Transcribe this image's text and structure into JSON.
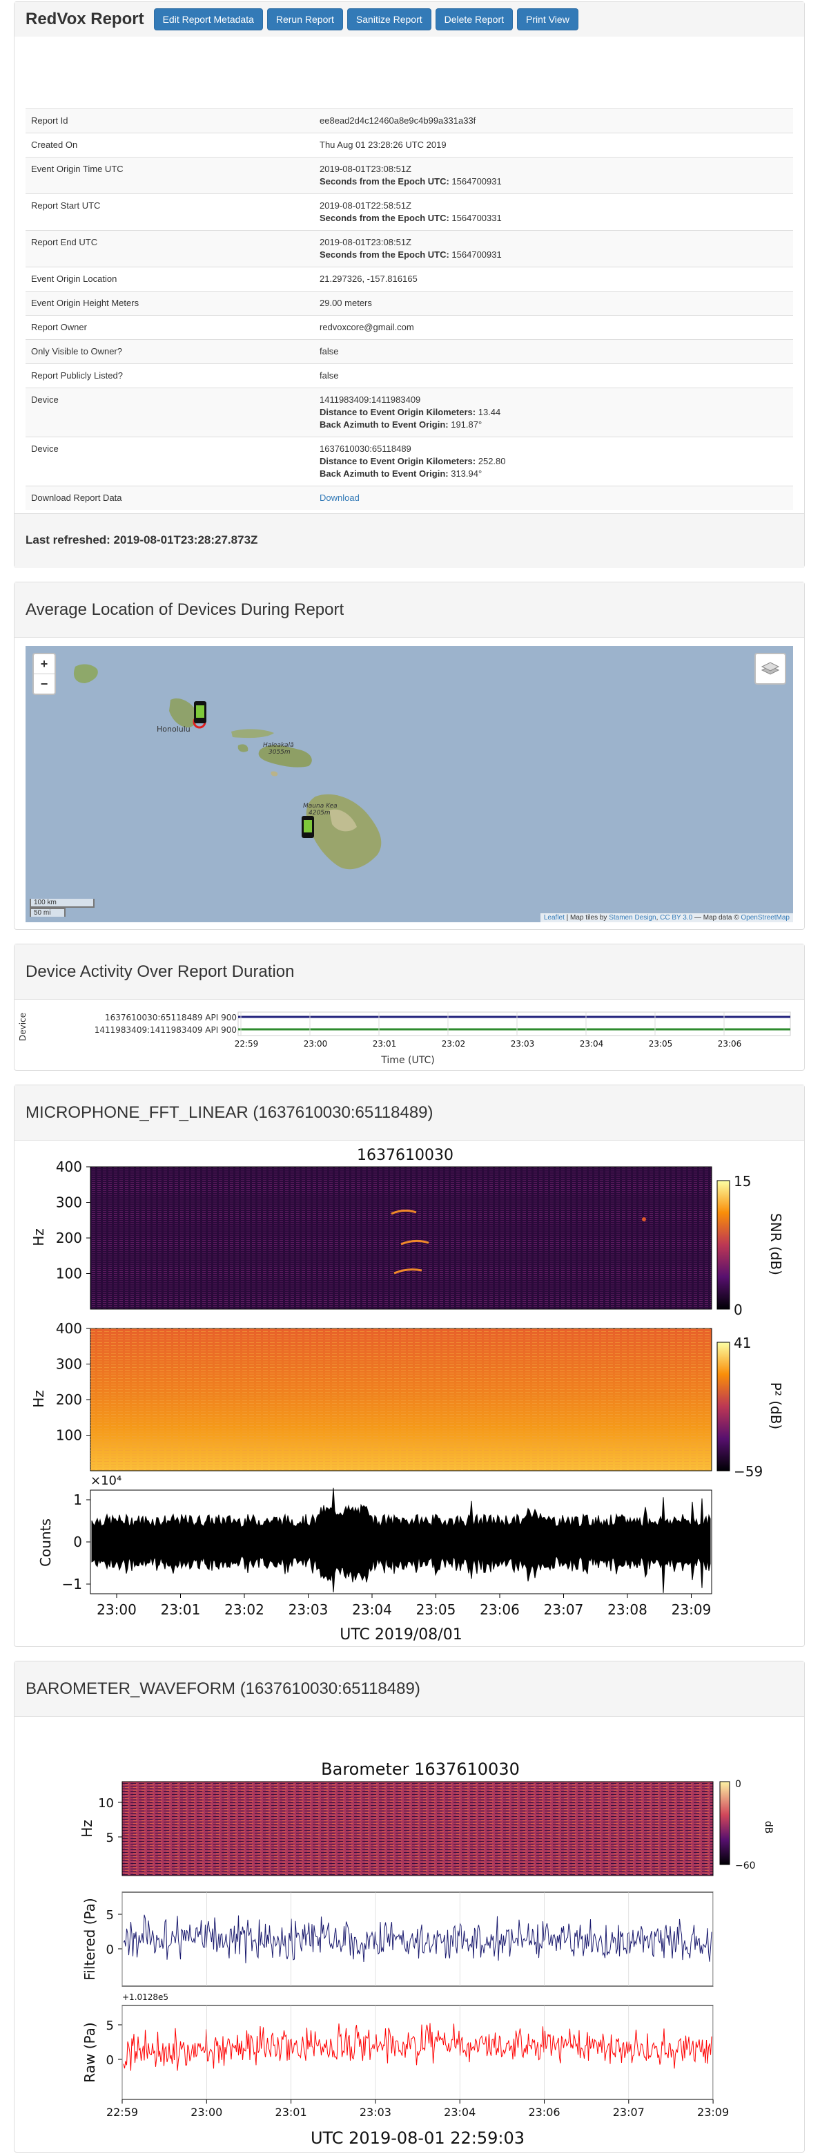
{
  "header": {
    "title": "RedVox Report",
    "buttons": [
      "Edit Report Metadata",
      "Rerun Report",
      "Sanitize Report",
      "Delete Report",
      "Print View"
    ]
  },
  "metadata": [
    {
      "key": "Report Id",
      "value": "ee8ead2d4c12460a8e9c4b99a331a33f"
    },
    {
      "key": "Created On",
      "value": "Thu Aug 01 23:28:26 UTC 2019"
    },
    {
      "key": "Event Origin Time UTC",
      "value": "2019-08-01T23:08:51Z",
      "sub": [
        {
          "label": "Seconds from the Epoch UTC:",
          "value": "1564700931"
        }
      ]
    },
    {
      "key": "Report Start UTC",
      "value": "2019-08-01T22:58:51Z",
      "sub": [
        {
          "label": "Seconds from the Epoch UTC:",
          "value": "1564700331"
        }
      ]
    },
    {
      "key": "Report End UTC",
      "value": "2019-08-01T23:08:51Z",
      "sub": [
        {
          "label": "Seconds from the Epoch UTC:",
          "value": "1564700931"
        }
      ]
    },
    {
      "key": "Event Origin Location",
      "value": "21.297326, -157.816165"
    },
    {
      "key": "Event Origin Height Meters",
      "value": "29.00 meters"
    },
    {
      "key": "Report Owner",
      "value": "redvoxcore@gmail.com"
    },
    {
      "key": "Only Visible to Owner?",
      "value": "false"
    },
    {
      "key": "Report Publicly Listed?",
      "value": "false"
    },
    {
      "key": "Device",
      "value": "1411983409:1411983409",
      "sub": [
        {
          "label": "Distance to Event Origin Kilometers:",
          "value": "13.44"
        },
        {
          "label": "Back Azimuth to Event Origin:",
          "value": "191.87°"
        }
      ]
    },
    {
      "key": "Device",
      "value": "1637610030:65118489",
      "sub": [
        {
          "label": "Distance to Event Origin Kilometers:",
          "value": "252.80"
        },
        {
          "label": "Back Azimuth to Event Origin:",
          "value": "313.94°"
        }
      ]
    },
    {
      "key": "Download Report Data",
      "value": "Download",
      "link": true
    }
  ],
  "refresh": "Last refreshed: 2019-08-01T23:28:27.873Z",
  "map": {
    "title": "Average Location of Devices During Report",
    "zoom_in": "+",
    "zoom_out": "−",
    "places": [
      "Honolulu",
      "Haleakalā",
      "3055m",
      "Mauna Kea",
      "4205m"
    ],
    "scale": [
      "100 km",
      "50 mi"
    ],
    "attribution": {
      "leaflet": "Leaflet",
      "tiles_prefix": " | Map tiles by ",
      "stamen": "Stamen Design",
      "sep": ", ",
      "cc": "CC BY 3.0",
      "data_prefix": " — Map data © ",
      "osm": "OpenStreetMap"
    }
  },
  "activity": {
    "title": "Device Activity Over Report Duration",
    "ylabel": "Device",
    "xlabel": "Time (UTC)",
    "devices": [
      "1637610030:65118489 API 900",
      "1411983409:1411983409 API 900"
    ],
    "colors": [
      "#1f1f7a",
      "#2e8b2e"
    ],
    "ticks": [
      "22:59",
      "23:00",
      "23:01",
      "23:02",
      "23:03",
      "23:04",
      "23:05",
      "23:06"
    ]
  },
  "fft": {
    "title": "MICROPHONE_FFT_LINEAR (1637610030:65118489)",
    "plot_title": "1637610030",
    "hz_ticks": [
      "400",
      "300",
      "200",
      "100"
    ],
    "hz_label": "Hz",
    "snr": {
      "label": "SNR (dB)",
      "max": "15",
      "min": "0"
    },
    "p2": {
      "label": "P² (dB)",
      "max": "41",
      "min": "−59"
    },
    "exp": "×10⁴",
    "counts_ticks": [
      "1",
      "0",
      "−1"
    ],
    "counts_label": "Counts",
    "x_ticks": [
      "23:00",
      "23:01",
      "23:02",
      "23:03",
      "23:04",
      "23:05",
      "23:06",
      "23:07",
      "23:08",
      "23:09"
    ],
    "x_label": "UTC 2019/08/01"
  },
  "baro": {
    "title": "BAROMETER_WAVEFORM (1637610030:65118489)",
    "plot_title": "Barometer 1637610030",
    "hz_label": "Hz",
    "hz_ticks": [
      "10",
      "5"
    ],
    "cbar": {
      "label": "dB",
      "max": "0",
      "min": "−60"
    },
    "filtered_label": "Filtered (Pa)",
    "filtered_ticks": [
      "5",
      "0"
    ],
    "raw_label": "Raw (Pa)",
    "raw_offset": "+1.0128e5",
    "raw_ticks": [
      "5",
      "0"
    ],
    "x_ticks": [
      "22:59",
      "23:00",
      "23:01",
      "23:03",
      "23:04",
      "23:06",
      "23:07",
      "23:09"
    ],
    "x_label": "UTC 2019-08-01 22:59:03",
    "colors": {
      "filtered": "#1a1a6e",
      "raw": "#ff0000"
    }
  }
}
